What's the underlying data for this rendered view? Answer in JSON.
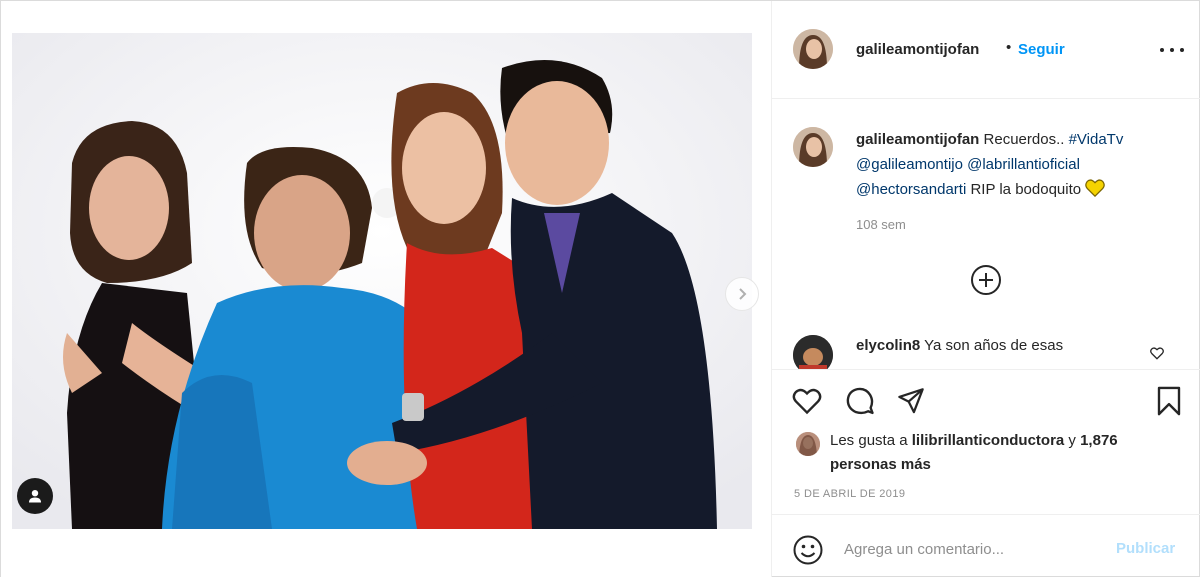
{
  "post": {
    "username": "galileamontijofan",
    "separator": "•",
    "follow_label": "Seguir",
    "more_icon": "more-horizontal-icon"
  },
  "caption": {
    "username": "galileamontijofan",
    "text": "Recuerdos..",
    "hashtag": "#VidaTv",
    "mention_1": "@galileamontijo",
    "mention_2": "@labrillantioficial",
    "mention_3": "@hectorsandarti",
    "text_end": "RIP la bodoquito",
    "emoji": "yellow-heart-icon",
    "time": "108 sem"
  },
  "load_more_icon": "plus-circle-icon",
  "comments": [
    {
      "username": "elycolin8",
      "text": "Ya son años de esas"
    }
  ],
  "actions": {
    "like_icon": "heart-icon",
    "comment_icon": "comment-icon",
    "share_icon": "share-icon",
    "save_icon": "bookmark-icon"
  },
  "likes": {
    "prefix": "Les gusta a",
    "user": "lilibrillanticonductora",
    "conjunction": "y",
    "others": "1,876 personas más"
  },
  "date": "5 de abril de 2019",
  "add_comment": {
    "placeholder": "Agrega un comentario...",
    "publish_label": "Publicar"
  },
  "colors": {
    "link_blue": "#0095f6",
    "mention_navy": "#00376b",
    "muted_gray": "#8e8e8e",
    "publish_disabled": "#b2dffc"
  }
}
